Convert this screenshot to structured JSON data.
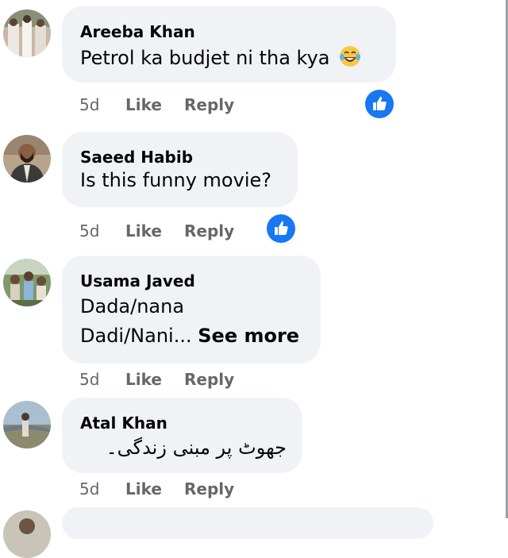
{
  "colors": {
    "bubble": "#f0f2f5",
    "text": "#050505",
    "meta": "#65676b",
    "like_blue": "#1877f2"
  },
  "comments": [
    {
      "author": "Areeba Khan",
      "lines": [
        "Petrol ka budjet ni tha kya"
      ],
      "emoji": "laughing-tears-emoji",
      "time": "5d",
      "like_label": "Like",
      "reply_label": "Reply",
      "reaction": "like"
    },
    {
      "author": "Saeed Habib",
      "lines": [
        "Is this funny movie?"
      ],
      "time": "5d",
      "like_label": "Like",
      "reply_label": "Reply",
      "reaction": "like"
    },
    {
      "author": "Usama Javed",
      "lines": [
        "Dada/nana",
        "Dadi/Nani..."
      ],
      "see_more": "See more",
      "time": "5d",
      "like_label": "Like",
      "reply_label": "Reply"
    },
    {
      "author": "Atal Khan",
      "lines": [
        "جھوٹ پر مبنی زندگی۔"
      ],
      "time": "5d",
      "like_label": "Like",
      "reply_label": "Reply"
    }
  ]
}
